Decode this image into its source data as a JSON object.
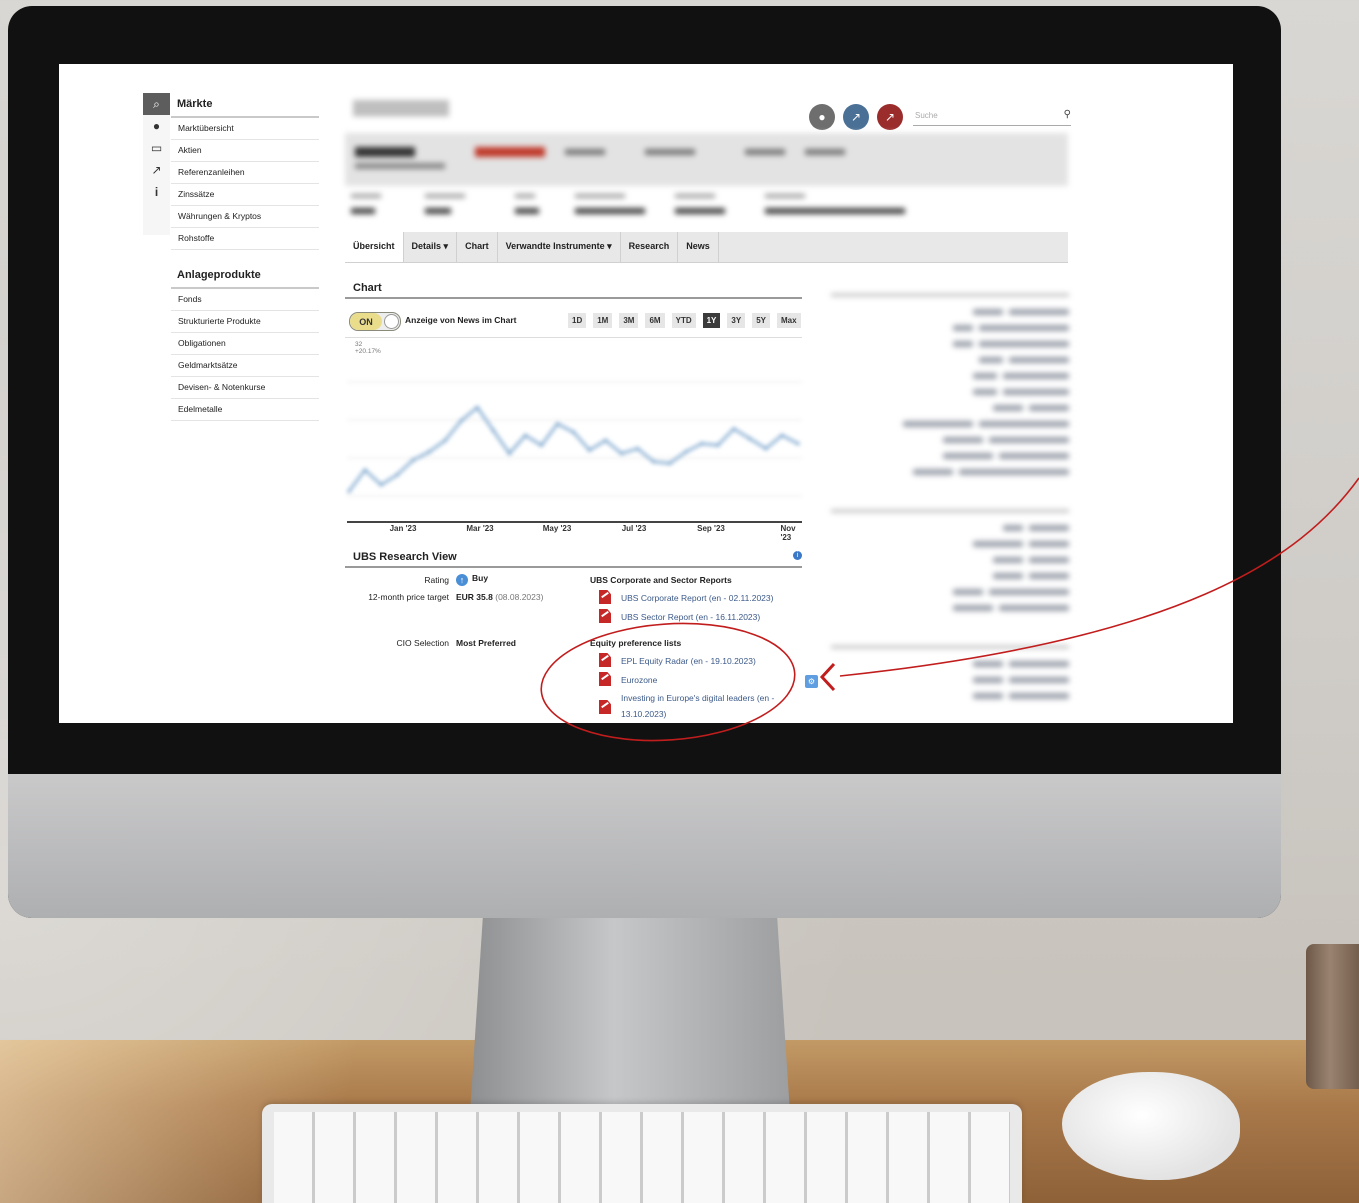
{
  "brand_colors": {
    "accent_red": "#c62828",
    "link_blue": "#3c5a8a",
    "info_blue": "#3b78c8",
    "toggle_on": "#e9dd8c"
  },
  "search": {
    "placeholder": "Suche"
  },
  "header_icons": [
    {
      "name": "globe-icon",
      "glyph": "●",
      "color": "#6e6e6e"
    },
    {
      "name": "trend-icon",
      "glyph": "↗",
      "color": "#4a7096"
    },
    {
      "name": "trend-red-icon",
      "glyph": "↗",
      "color": "#9b2c2c"
    }
  ],
  "rail": [
    {
      "name": "search-icon",
      "glyph": "⌕"
    },
    {
      "name": "globe-icon",
      "glyph": "●"
    },
    {
      "name": "card-icon",
      "glyph": "▭"
    },
    {
      "name": "trend-icon",
      "glyph": "↗"
    },
    {
      "name": "info-icon",
      "glyph": "i"
    }
  ],
  "nav": {
    "section1": "Märkte",
    "items1": [
      "Marktübersicht",
      "Aktien",
      "Referenzanleihen",
      "Zinssätze",
      "Währungen & Kryptos",
      "Rohstoffe"
    ],
    "section2": "Anlageprodukte",
    "items2": [
      "Fonds",
      "Strukturierte Produkte",
      "Obligationen",
      "Geldmarktsätze",
      "Devisen- & Notenkurse",
      "Edelmetalle"
    ]
  },
  "tabs": [
    "Übersicht",
    "Details",
    "Chart",
    "Verwandte Instrumente",
    "Research",
    "News"
  ],
  "chart": {
    "title": "Chart",
    "toggle_label": "ON",
    "news_label": "Anzeige von News im Chart",
    "ranges": [
      "1D",
      "1M",
      "3M",
      "6M",
      "YTD",
      "1Y",
      "3Y",
      "5Y",
      "Max"
    ],
    "active_range": "1Y",
    "top_value": "32",
    "top_change": "+20.17%"
  },
  "chart_data": {
    "type": "line",
    "title": "",
    "x_ticks": [
      "Jan '23",
      "Mar '23",
      "May '23",
      "Jul '23",
      "Sep '23",
      "Nov '23"
    ],
    "series": [
      {
        "values": [
          24.5,
          25.8,
          24.9,
          25.5,
          26.4,
          26.9,
          27.6,
          28.8,
          29.6,
          28.2,
          26.8,
          27.9,
          27.3,
          28.6,
          28.1,
          27.0,
          27.6,
          26.8,
          27.1,
          26.3,
          26.2,
          26.9,
          27.4,
          27.3,
          28.3,
          27.7,
          27.1,
          27.9,
          27.4
        ]
      }
    ],
    "ylim": [
      23,
      32
    ],
    "grid": true
  },
  "research": {
    "title": "UBS Research View",
    "rating_label": "Rating",
    "rating_value": "Buy",
    "target_label": "12-month price target",
    "target_value": "EUR 35.8",
    "target_date": "(08.08.2023)",
    "cio_label": "CIO Selection",
    "cio_value": "Most Preferred",
    "reports_head": "UBS Corporate and Sector Reports",
    "reports": [
      "UBS Corporate Report (en - 02.11.2023)",
      "UBS Sector Report (en - 16.11.2023)"
    ],
    "pref_head": "Equity preference lists",
    "pref": [
      "EPL Equity Radar (en - 19.10.2023)",
      "Eurozone",
      "Investing in Europe's digital leaders (en - 13.10.2023)"
    ]
  }
}
